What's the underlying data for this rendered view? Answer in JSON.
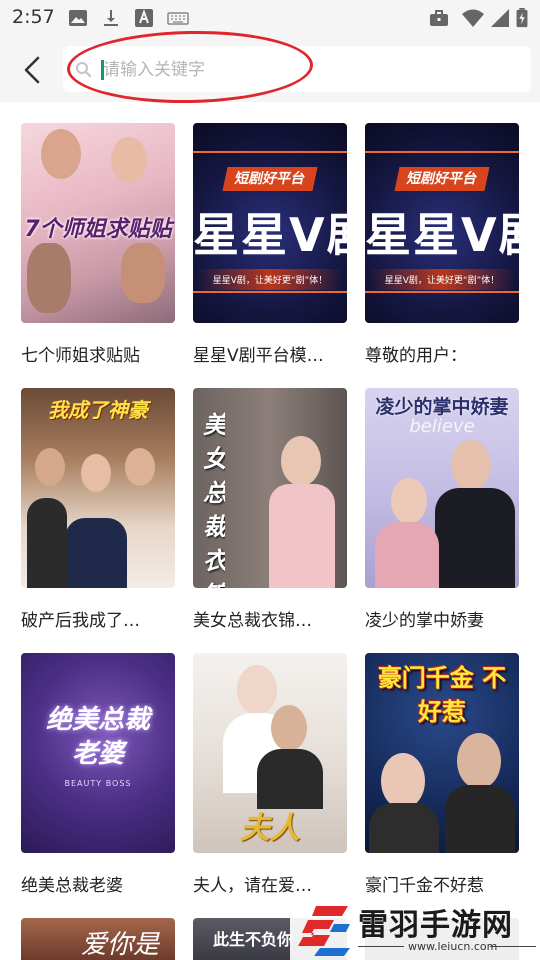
{
  "status_bar": {
    "time": "2:57",
    "left_icons": [
      "image-icon",
      "download-icon",
      "font-icon",
      "keyboard-icon"
    ],
    "right_icons": [
      "briefcase-icon",
      "wifi-icon",
      "signal-icon",
      "battery-icon"
    ]
  },
  "header": {
    "back_icon": "chevron-left-icon",
    "search_placeholder": "请输入关键字",
    "search_value": ""
  },
  "accent_colors": {
    "cursor": "#0e9a74",
    "annotation": "#e0252e"
  },
  "dramas": [
    {
      "title": "七个师姐求贴贴",
      "poster_text": "7个师姐求贴贴",
      "poster_theme": "pink"
    },
    {
      "title": "星星V剧平台模…",
      "poster_text": "星星V剧",
      "poster_badge": "短剧好平台",
      "poster_slogan": "星星V剧，让美好更“剧”体！",
      "poster_theme": "tech-orange"
    },
    {
      "title": "尊敬的用户：",
      "poster_text": "星星V剧",
      "poster_badge": "短剧好平台",
      "poster_slogan": "星星V剧，让美好更“剧”体！",
      "poster_theme": "tech-orange"
    },
    {
      "title": "破产后我成了…",
      "poster_text": "我成了神豪",
      "poster_theme": "wedding"
    },
    {
      "title": "美女总裁衣锦…",
      "poster_text": "美女总裁 衣锦还乡",
      "poster_theme": "brick"
    },
    {
      "title": "凌少的掌中娇妻",
      "poster_text": "凌少的掌中娇妻",
      "poster_sub": "believe",
      "poster_theme": "lavender"
    },
    {
      "title": "绝美总裁老婆",
      "poster_text": "绝美总裁老婆",
      "poster_sub": "BEAUTY BOSS",
      "poster_theme": "purple"
    },
    {
      "title": "夫人，请在爱…",
      "poster_text": "夫人",
      "poster_theme": "white"
    },
    {
      "title": "豪门千金不好惹",
      "poster_text": "豪门千金 不好惹",
      "poster_theme": "night-stars"
    }
  ],
  "partial_row": [
    {
      "poster_text": "爱你是",
      "poster_theme": "warm"
    },
    {
      "poster_text": "此生不负你",
      "poster_theme": "grey"
    }
  ],
  "watermark": {
    "brand": "雷羽手游网",
    "url": "www.leiucn.com"
  }
}
